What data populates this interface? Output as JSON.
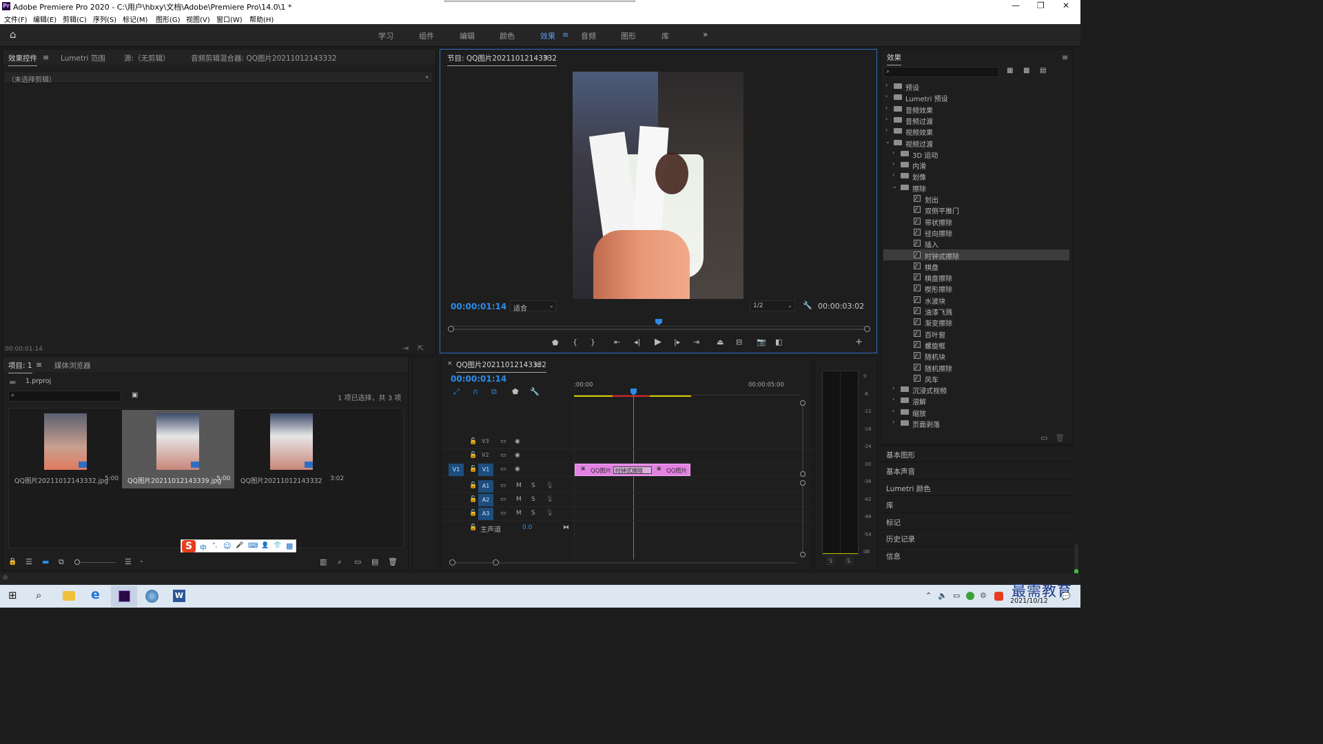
{
  "window": {
    "title": "Adobe Premiere Pro 2020 - C:\\用户\\hbxy\\文档\\Adobe\\Premiere Pro\\14.0\\1 *",
    "logo": "Pr"
  },
  "menu": [
    "文件(F)",
    "编辑(E)",
    "剪辑(C)",
    "序列(S)",
    "标记(M)",
    "图形(G)",
    "视图(V)",
    "窗口(W)",
    "帮助(H)"
  ],
  "workspaces": [
    "学习",
    "组件",
    "编辑",
    "颜色",
    "效果",
    "音频",
    "图形",
    "库"
  ],
  "active_workspace": "效果",
  "source_panel": {
    "tabs": [
      "效果控件",
      "Lumetri 范围",
      "源:（无剪辑）",
      "音频剪辑混合器: QQ图片20211012143332"
    ],
    "no_clip": "（未选择剪辑）",
    "timecode": "00:00:01:14"
  },
  "program": {
    "title": "节目: QQ图片20211012143332",
    "timecode": "00:00:01:14",
    "fit": "适合",
    "resolution": "1/2",
    "duration": "00:00:03:02",
    "playhead_fraction": 0.5
  },
  "project": {
    "tabs": [
      "项目: 1",
      "媒体浏览器"
    ],
    "file": "1.prproj",
    "selection_info": "1 项已选择，共 3 项",
    "items": [
      {
        "name": "QQ图片20211012143332.jpg",
        "duration": "5:00"
      },
      {
        "name": "QQ图片20211012143339.jpg",
        "duration": "5:00"
      },
      {
        "name": "QQ图片20211012143332",
        "duration": "3:02"
      }
    ]
  },
  "ime": [
    "中",
    "°,",
    "☺",
    "🎤",
    "⌨",
    "👤",
    "👕",
    "▦"
  ],
  "timeline": {
    "sequence": "QQ图片20211012143332",
    "timecode": "00:00:01:14",
    "ruler": [
      ":00:00",
      "00:00:05:00"
    ],
    "video_tracks": [
      "V3",
      "V2",
      "V1"
    ],
    "audio_tracks": [
      "A1",
      "A2",
      "A3"
    ],
    "master": "主声道",
    "master_value": "0.0",
    "clips": [
      "QQ图片",
      "QQ图片"
    ],
    "transition": "时钟式擦除",
    "mute": "M",
    "solo": "S",
    "source_patch": "V1"
  },
  "meter": {
    "scale": [
      "0",
      "-6",
      "-12",
      "-18",
      "-24",
      "-30",
      "-36",
      "-42",
      "-48",
      "-54",
      "dB"
    ],
    "buttons": [
      "S",
      "S"
    ]
  },
  "effects": {
    "title": "效果",
    "folders_top": [
      "预设",
      "Lumetri 预设",
      "音频效果",
      "音频过渡",
      "视频效果",
      "视频过渡"
    ],
    "video_transition_groups": [
      "3D 运动",
      "内滑",
      "划像",
      "擦除"
    ],
    "wipe_items": [
      "划出",
      "双侧平推门",
      "带状擦除",
      "径向擦除",
      "插入",
      "时钟式擦除",
      "棋盘",
      "棋盘擦除",
      "楔形擦除",
      "水波块",
      "油漆飞溅",
      "渐变擦除",
      "百叶窗",
      "螺旋框",
      "随机块",
      "随机擦除",
      "风车"
    ],
    "selected": "时钟式擦除",
    "folders_after": [
      "沉浸式视频",
      "溶解",
      "缩放",
      "页面剥落"
    ],
    "side_panels": [
      "基本图形",
      "基本声音",
      "Lumetri 颜色",
      "库",
      "标记",
      "历史记录",
      "信息"
    ]
  },
  "taskbar": {
    "date": "2021/10/12",
    "watermark": "最需教育"
  }
}
